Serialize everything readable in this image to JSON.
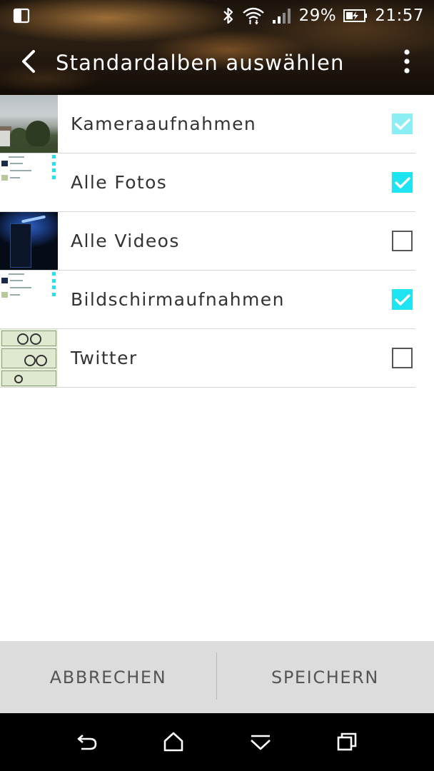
{
  "status_bar": {
    "battery_percent": "29%",
    "time": "21:57",
    "icons": [
      "multi-window-icon",
      "bluetooth-icon",
      "wifi-icon",
      "signal-icon",
      "battery-charging-icon"
    ]
  },
  "action_bar": {
    "title": "Standardalben auswählen",
    "back_icon": "back-arrow-icon",
    "overflow_icon": "more-vert-icon"
  },
  "albums": [
    {
      "label": "Kameraaufnahmen",
      "checked": true,
      "disabled": true,
      "thumbnail": "photo"
    },
    {
      "label": "Alle Fotos",
      "checked": true,
      "disabled": false,
      "thumbnail": "screenshot"
    },
    {
      "label": "Alle Videos",
      "checked": false,
      "disabled": false,
      "thumbnail": "video"
    },
    {
      "label": "Bildschirmaufnahmen",
      "checked": true,
      "disabled": false,
      "thumbnail": "screenshot"
    },
    {
      "label": "Twitter",
      "checked": false,
      "disabled": false,
      "thumbnail": "comic"
    }
  ],
  "footer": {
    "cancel_label": "ABBRECHEN",
    "save_label": "SPEICHERN"
  },
  "nav_bar": {
    "icons": [
      "back-nav-icon",
      "home-icon",
      "notifications-pulldown-icon",
      "recent-apps-icon"
    ]
  },
  "colors": {
    "accent": "#1ee3f0",
    "accent_disabled": "#8beef4",
    "footer_bg": "#dcdcdc",
    "nav_bg": "#000000"
  }
}
